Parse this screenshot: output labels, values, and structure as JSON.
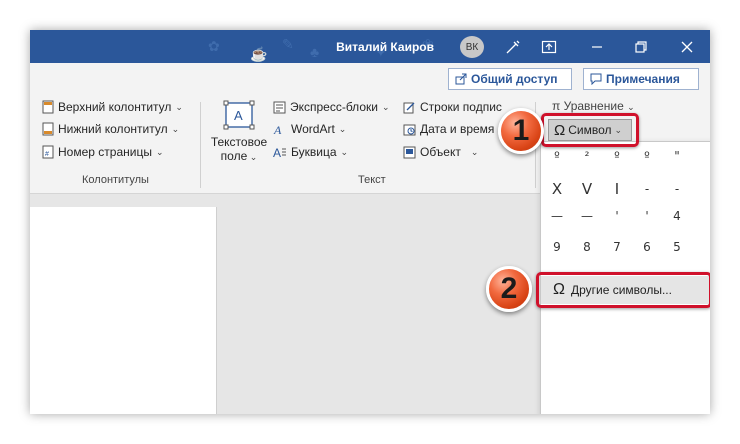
{
  "titlebar": {
    "user_name": "Виталий Каиров",
    "avatar_initials": "ВК"
  },
  "ribbon": {
    "share_label": "Общий доступ",
    "comments_label": "Примечания",
    "header_footer": {
      "header_label": "Верхний колонтитул",
      "footer_label": "Нижний колонтитул",
      "page_number_label": "Номер страницы",
      "group_label": "Колонтитулы"
    },
    "text_group": {
      "textbox_label_line1": "Текстовое",
      "textbox_label_line2": "поле",
      "quick_parts_label": "Экспресс-блоки",
      "wordart_label": "WordArt",
      "dropcap_label": "Буквица",
      "signature_line_label": "Строки подпис",
      "date_time_label": "Дата и время",
      "object_label": "Объект",
      "group_label": "Текст"
    },
    "symbols": {
      "equation_label": "Уравнение",
      "symbol_label": "Символ"
    }
  },
  "symbol_dropdown": {
    "symbols": [
      "º",
      "²",
      "º",
      "º",
      "\"",
      "-",
      "-",
      "X",
      "V",
      "I",
      "—",
      "—",
      "—",
      "—",
      "'",
      "'",
      "4",
      "9",
      "8",
      "7",
      "6",
      "5"
    ],
    "more_symbols_label": "Другие символы..."
  },
  "callouts": {
    "badge_1": "1",
    "badge_2": "2"
  },
  "colors": {
    "titlebar": "#2b579a",
    "highlight": "#d0112b",
    "badge": "#e8552b"
  }
}
